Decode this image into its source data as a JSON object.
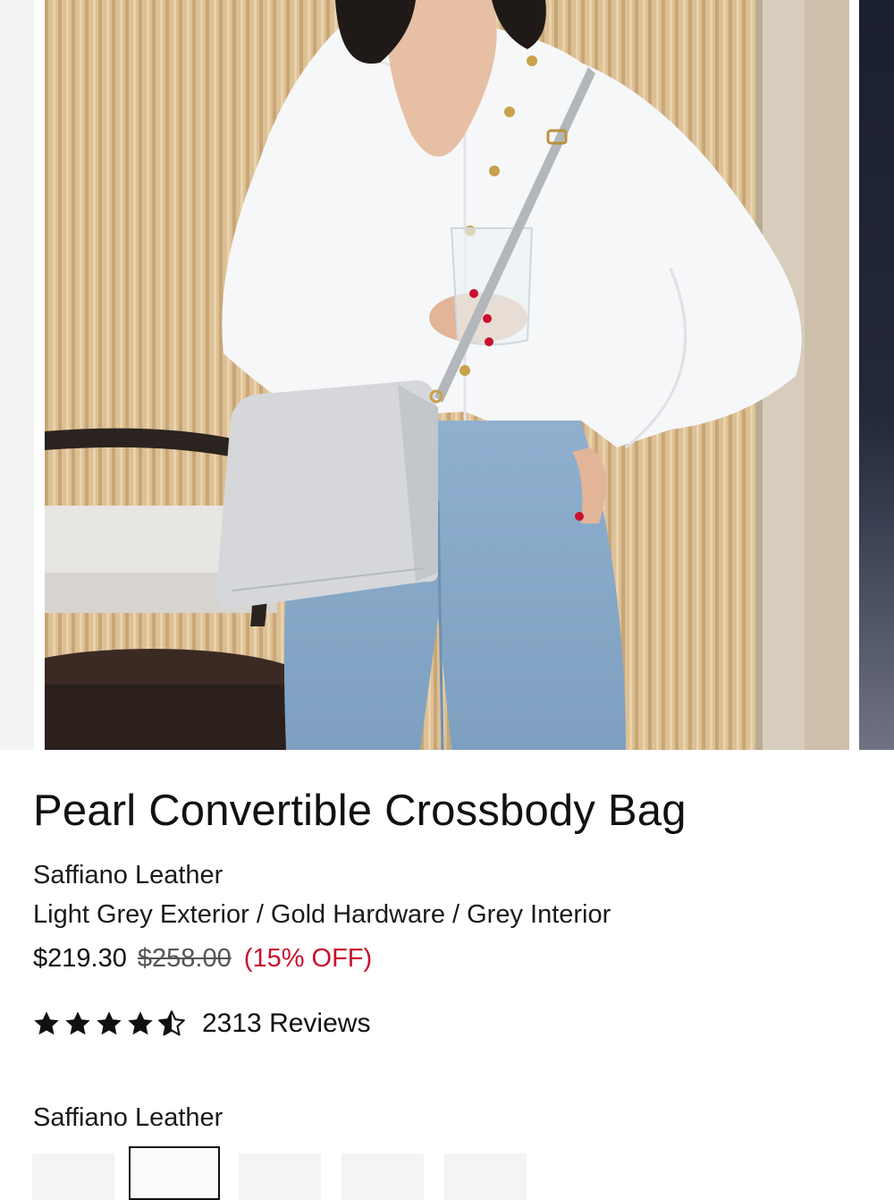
{
  "product": {
    "title": "Pearl Convertible Crossbody Bag",
    "material": "Saffiano Leather",
    "variant": "Light Grey Exterior / Gold Hardware / Grey Interior",
    "price": {
      "sale": "$219.30",
      "original": "$258.00",
      "discount": "(15% OFF)"
    },
    "rating": {
      "value": 4.5,
      "max": 5,
      "reviews_label": "2313 Reviews"
    }
  },
  "options": {
    "material_label": "Saffiano Leather",
    "swatch_count": 5,
    "selected_swatch_index": 1
  },
  "colors": {
    "discount_red": "#c8102e",
    "text": "#111111"
  },
  "icons": {
    "star": "star-icon",
    "half_star": "star-half-icon"
  }
}
